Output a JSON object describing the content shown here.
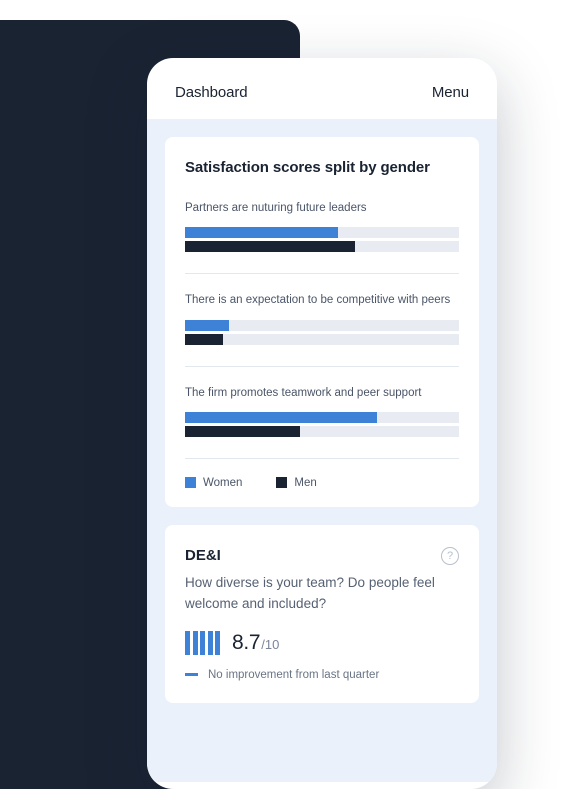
{
  "header": {
    "title": "Dashboard",
    "menu": "Menu"
  },
  "satisfaction": {
    "title": "Satisfaction scores split by gender",
    "items": [
      {
        "label": "Partners are nuturing future leaders"
      },
      {
        "label": "There is an expectation to be competitive with peers"
      },
      {
        "label": "The firm promotes teamwork and peer support"
      }
    ],
    "legend": {
      "women": "Women",
      "men": "Men"
    }
  },
  "dei": {
    "title": "DE&I",
    "question": "How diverse is your team? Do people feel welcome and included?",
    "score": "8.7",
    "max": "/10",
    "trend": "No improvement from last quarter"
  },
  "chart_data": {
    "type": "bar",
    "title": "Satisfaction scores split by gender",
    "categories": [
      "Partners are nuturing future leaders",
      "There is an expectation to be competitive with peers",
      "The firm promotes teamwork and peer support"
    ],
    "series": [
      {
        "name": "Women",
        "values": [
          56,
          16,
          70
        ],
        "color": "#3d82d6"
      },
      {
        "name": "Men",
        "values": [
          62,
          14,
          42
        ],
        "color": "#1a2332"
      }
    ],
    "xlim": [
      0,
      100
    ]
  },
  "colors": {
    "women": "#3d82d6",
    "men": "#1a2332"
  }
}
